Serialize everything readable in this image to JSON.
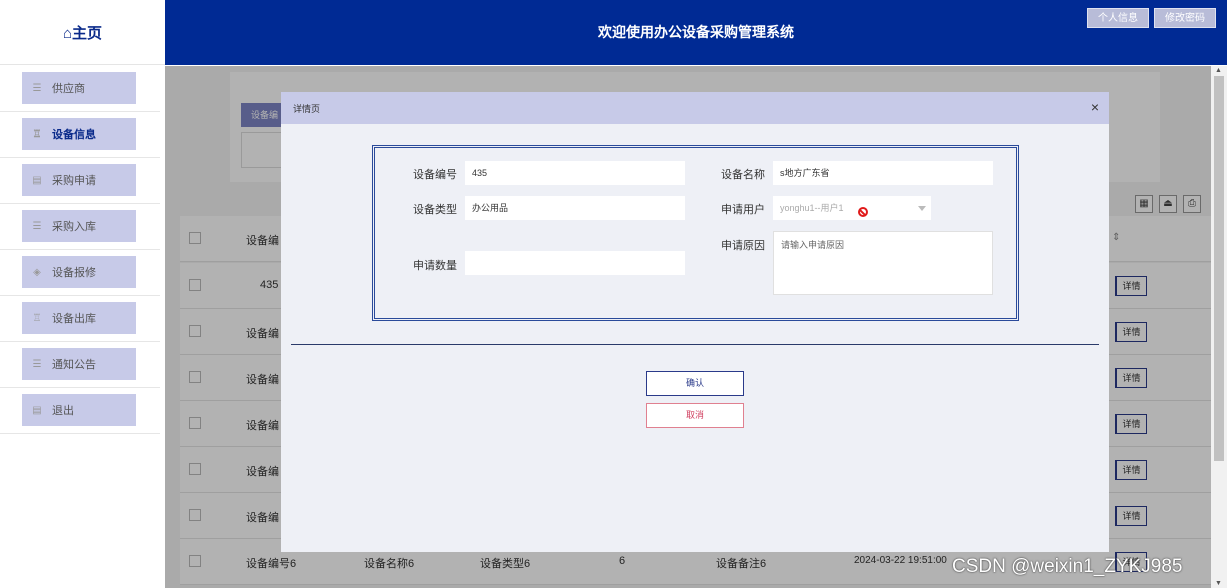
{
  "header": {
    "home": "⌂主页",
    "title": "欢迎使用办公设备采购管理系统",
    "profile_btn": "个人信息",
    "password_btn": "修改密码"
  },
  "sidebar": {
    "items": [
      {
        "label": "供应商",
        "icon": "list-icon"
      },
      {
        "label": "设备信息",
        "icon": "trash-icon",
        "active": true
      },
      {
        "label": "采购申请",
        "icon": "doc-icon"
      },
      {
        "label": "采购入库",
        "icon": "list-icon"
      },
      {
        "label": "设备报修",
        "icon": "layers-icon"
      },
      {
        "label": "设备出库",
        "icon": "trash-icon"
      },
      {
        "label": "通知公告",
        "icon": "list-icon"
      },
      {
        "label": "退出",
        "icon": "doc-icon"
      }
    ]
  },
  "background": {
    "search_button": "设备编",
    "table": {
      "header_first": "设备编",
      "rows": [
        {
          "c1": "435"
        },
        {
          "c1": "设备编"
        },
        {
          "c1": "设备编"
        },
        {
          "c1": "设备编"
        },
        {
          "c1": "设备编"
        },
        {
          "c1": "设备编"
        },
        {
          "c1": "设备编号6",
          "c2": "设备名称6",
          "c3": "设备类型6",
          "c4": "6",
          "c5": "设备备注6",
          "c6": "2024-03-22 19:51:00"
        }
      ],
      "detail_label": "详情"
    }
  },
  "modal": {
    "title": "详情页",
    "close": "×",
    "fields": {
      "device_no_label": "设备编号",
      "device_no_value": "435",
      "device_name_label": "设备名称",
      "device_name_value": "s地方广东省",
      "device_type_label": "设备类型",
      "device_type_value": "办公用品",
      "apply_user_label": "申请用户",
      "apply_user_value": "yonghu1--用户1",
      "apply_reason_label": "申请原因",
      "apply_reason_placeholder": "请输入申请原因",
      "apply_qty_label": "申请数量",
      "apply_qty_value": ""
    },
    "confirm": "确认",
    "cancel": "取消"
  },
  "watermark": "CSDN @weixin1_ZYKJ985"
}
